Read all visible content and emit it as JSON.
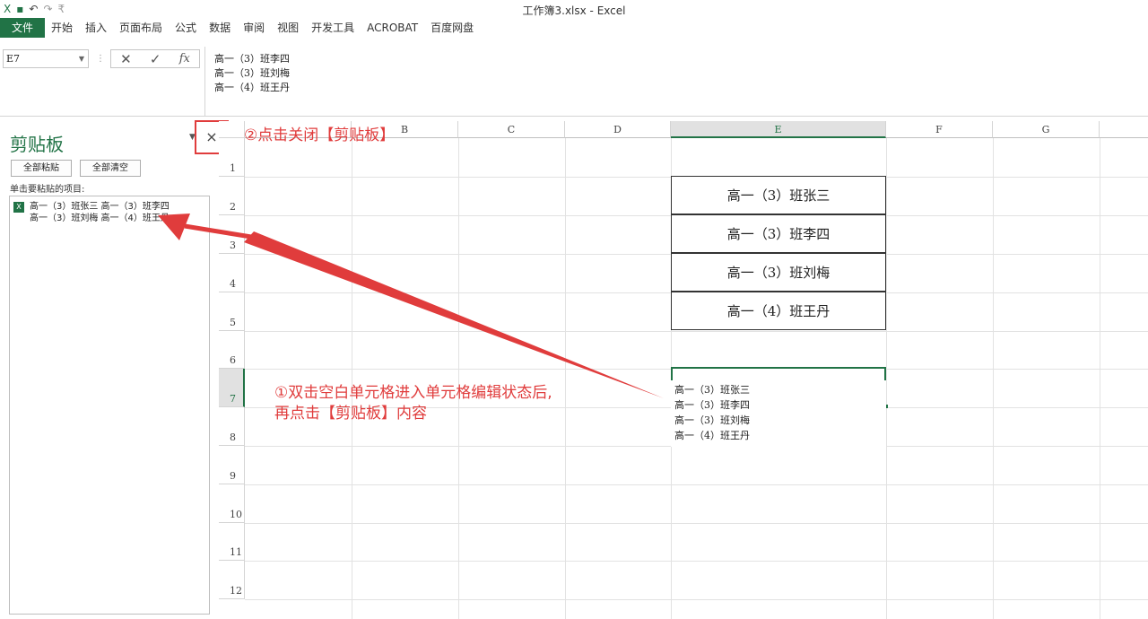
{
  "window": {
    "title": "工作簿3.xlsx - Excel"
  },
  "qat": {
    "excel_icon": "X",
    "save_icon": "▪",
    "undo_icon": "↶",
    "redo_icon": "↷",
    "customize_icon": "₹"
  },
  "ribbon": {
    "file_tab": "文件",
    "tabs": [
      "开始",
      "插入",
      "页面布局",
      "公式",
      "数据",
      "审阅",
      "视图",
      "开发工具",
      "ACROBAT",
      "百度网盘"
    ]
  },
  "formula_bar": {
    "name_box": "E7",
    "cancel_icon": "✕",
    "enter_icon": "✓",
    "fx_label": "fx",
    "content_lines": [
      "高一（3）班李四",
      "高一（3）班刘梅",
      "高一（4）班王丹"
    ]
  },
  "clipboard": {
    "title": "剪贴板",
    "close_label": "×",
    "paste_all": "全部粘贴",
    "clear_all": "全部清空",
    "hint": "单击要粘贴的项目:",
    "items": [
      {
        "line1": "高一（3）班张三 高一（3）班李四",
        "line2": "高一（3）班刘梅 高一（4）班王丹"
      }
    ]
  },
  "grid": {
    "columns": [
      "",
      "B",
      "C",
      "D",
      "E",
      "F",
      "G"
    ],
    "rows": [
      "1",
      "2",
      "3",
      "4",
      "5",
      "6",
      "7",
      "8",
      "9",
      "10",
      "11",
      "12"
    ],
    "selected_column": "E",
    "selected_row": "7",
    "e_cells": [
      "高一（3）班张三",
      "高一（3）班李四",
      "高一（3）班刘梅",
      "高一（4）班王丹"
    ],
    "edit_lines": [
      "高一（3）班张三",
      "高一（3）班李四",
      "高一（3）班刘梅",
      "高一（4）班王丹"
    ]
  },
  "annotations": {
    "step1_line1": "①双击空白单元格进入单元格编辑状态后,",
    "step1_line2": "再点击【剪贴板】内容",
    "step2": "②点击关闭【剪贴板】"
  },
  "colors": {
    "excel_green": "#217346",
    "annotation_red": "#e03c3c"
  }
}
